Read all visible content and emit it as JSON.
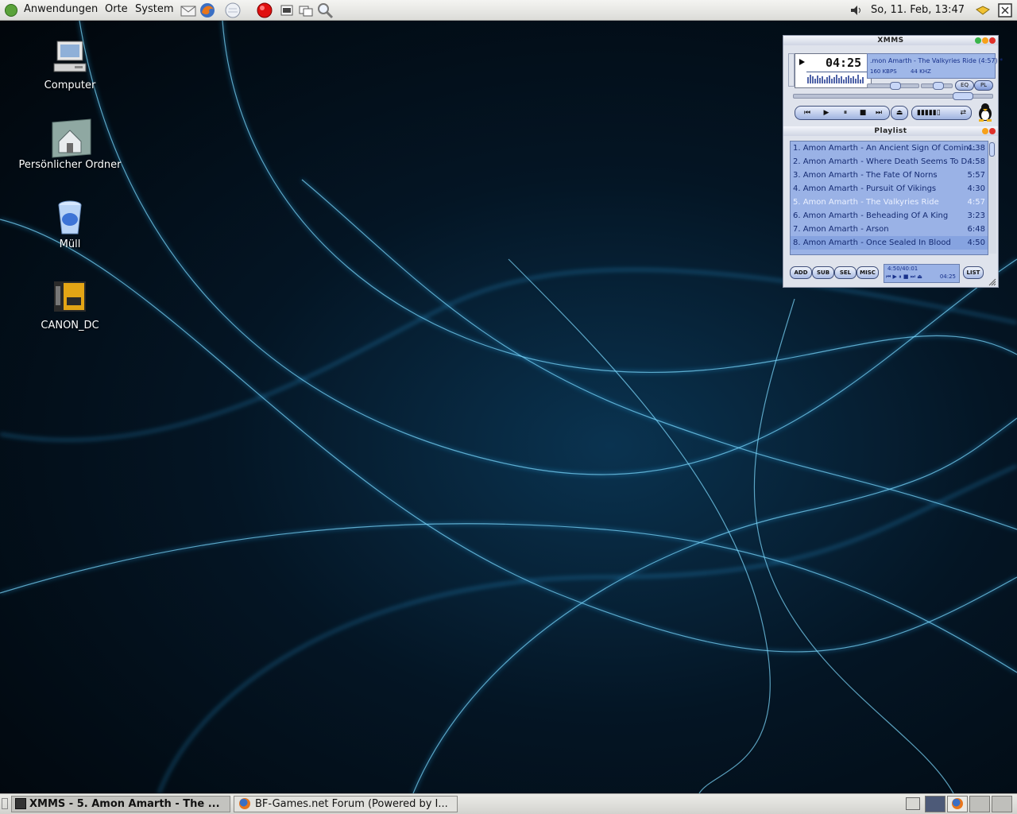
{
  "top_panel": {
    "menus": [
      "Anwendungen",
      "Orte",
      "System"
    ],
    "clock": "So, 11. Feb, 13:47"
  },
  "desktop": {
    "icons": [
      {
        "label": "Computer",
        "icon": "computer-icon"
      },
      {
        "label": "Persönlicher Ordner",
        "icon": "home-folder-icon"
      },
      {
        "label": "Müll",
        "icon": "trash-icon"
      },
      {
        "label": "CANON_DC",
        "icon": "camera-card-icon"
      }
    ]
  },
  "xmms": {
    "title": "XMMS",
    "time": "04:25",
    "song_title": ".mon Amarth - The Valkyries Ride (4:57) *",
    "bitrate": "160 KBPS",
    "samplerate": "44 KHZ",
    "eq_label": "EQ",
    "pl_label": "PL",
    "playlist_title": "Playlist",
    "playlist": [
      {
        "title": "1. Amon Amarth - An Ancient Sign Of Comin...",
        "duration": "4:38"
      },
      {
        "title": "2. Amon Amarth - Where Death Seems To D...",
        "duration": "4:58"
      },
      {
        "title": "3. Amon Amarth - The Fate Of Norns",
        "duration": "5:57"
      },
      {
        "title": "4. Amon Amarth - Pursuit Of Vikings",
        "duration": "4:30"
      },
      {
        "title": "5. Amon Amarth - The Valkyries Ride",
        "duration": "4:57"
      },
      {
        "title": "6. Amon Amarth - Beheading Of A King",
        "duration": "3:23"
      },
      {
        "title": "7. Amon Amarth - Arson",
        "duration": "6:48"
      },
      {
        "title": "8. Amon Amarth - Once Sealed In Blood",
        "duration": "4:50"
      }
    ],
    "current_index": 4,
    "playlist_buttons": [
      "ADD",
      "SUB",
      "SEL",
      "MISC"
    ],
    "list_button": "LIST",
    "total_time": "4:50/40:01",
    "mini_time": "04:25"
  },
  "taskbar": {
    "tasks": [
      {
        "label": "XMMS - 5. Amon Amarth - The ...",
        "active": true
      },
      {
        "label": "BF-Games.net Forum (Powered by I...",
        "active": false
      }
    ]
  },
  "colors": {
    "accent": "#9ab2e6",
    "panel": "#dcdcd8",
    "wallpaper": "#041524"
  }
}
